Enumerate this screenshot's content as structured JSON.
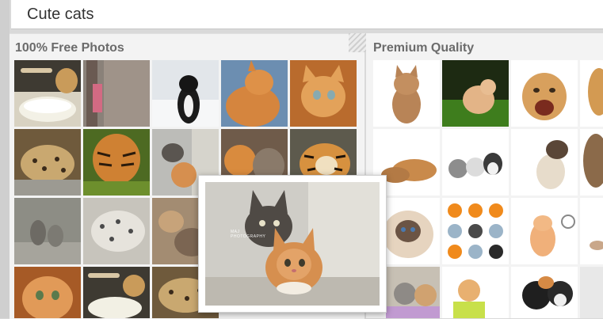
{
  "search": {
    "value": "Cute cats",
    "placeholder": ""
  },
  "sections": {
    "free_title": "100% Free Photos",
    "premium_title": "Premium Quality"
  },
  "preview": {
    "watermark_line1": "MAJ",
    "watermark_line2": "PHOTOGRAPHY"
  },
  "free_photos": [
    "kitten-drinking-milk",
    "legs-on-pavement",
    "black-white-cat-in-snow",
    "orange-tabby-cat",
    "orange-kitten-looking-up",
    "leopard-cub",
    "tiger-in-grass",
    "grey-and-orange-kittens",
    "playful-kittens",
    "tiger-lying",
    "grey-kittens-on-rock",
    "snow-leopard",
    "tabby-kittens",
    "kitten-tongue",
    "tabby-kittens-pair",
    "orange-kitten-closeup",
    "kitten-drinking-milk-2",
    "leopard-cub-2"
  ],
  "premium_photos": [
    "tabby-kitten-white-bg",
    "kitten-on-grass",
    "lion-cub-roaring",
    "lion-cub-partial",
    "kittens-lying",
    "three-kittens",
    "siamese-cat",
    "tabby-cat-partial",
    "persian-cat",
    "cartoon-cat-stickers",
    "orange-kitten-toy",
    "white-cat-partial",
    "kitten-in-basket",
    "orange-kitten-bag",
    "tuxedo-kittens",
    "grey-cat-partial"
  ],
  "colors": {
    "panel_bg": "#f3f3f3",
    "title": "#6b6b6b",
    "page_bg": "#d9d9d9"
  }
}
